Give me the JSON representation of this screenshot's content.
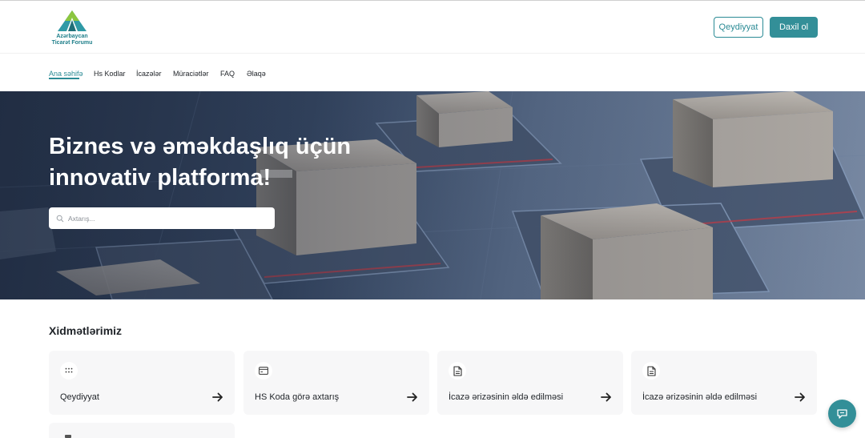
{
  "header": {
    "logo": {
      "line1": "Azərbaycan",
      "line2": "Ticarət Forumu",
      "icon": "triangle-logo"
    },
    "register_label": "Qeydiyyat",
    "login_label": "Daxil ol"
  },
  "nav": {
    "items": [
      {
        "label": "Ana səhifə",
        "active": true
      },
      {
        "label": "Hs Kodlar",
        "active": false
      },
      {
        "label": "İcazələr",
        "active": false
      },
      {
        "label": "Müraciətlər",
        "active": false
      },
      {
        "label": "FAQ",
        "active": false
      },
      {
        "label": "Əlaqə",
        "active": false
      }
    ]
  },
  "hero": {
    "title_line1": "Biznes və əməkdaşlıq üçün",
    "title_line2": "innovativ platforma!",
    "search_placeholder": "Axtarış..."
  },
  "services": {
    "title": "Xidmətlərimiz",
    "cards": [
      {
        "label": "Qeydiyyat",
        "icon": "dots-grid-icon"
      },
      {
        "label": "HS Koda görə axtarış",
        "icon": "card-icon"
      },
      {
        "label": "İcazə ərizəsinin əldə edilməsi",
        "icon": "document-icon"
      },
      {
        "label": "İcazə ərizəsinin əldə edilməsi",
        "icon": "document-icon"
      }
    ]
  },
  "colors": {
    "accent": "#338f98",
    "accent_text": "#2b8b95",
    "card_bg": "#f7f7f8",
    "hero_bg": "#3a4d6a"
  }
}
